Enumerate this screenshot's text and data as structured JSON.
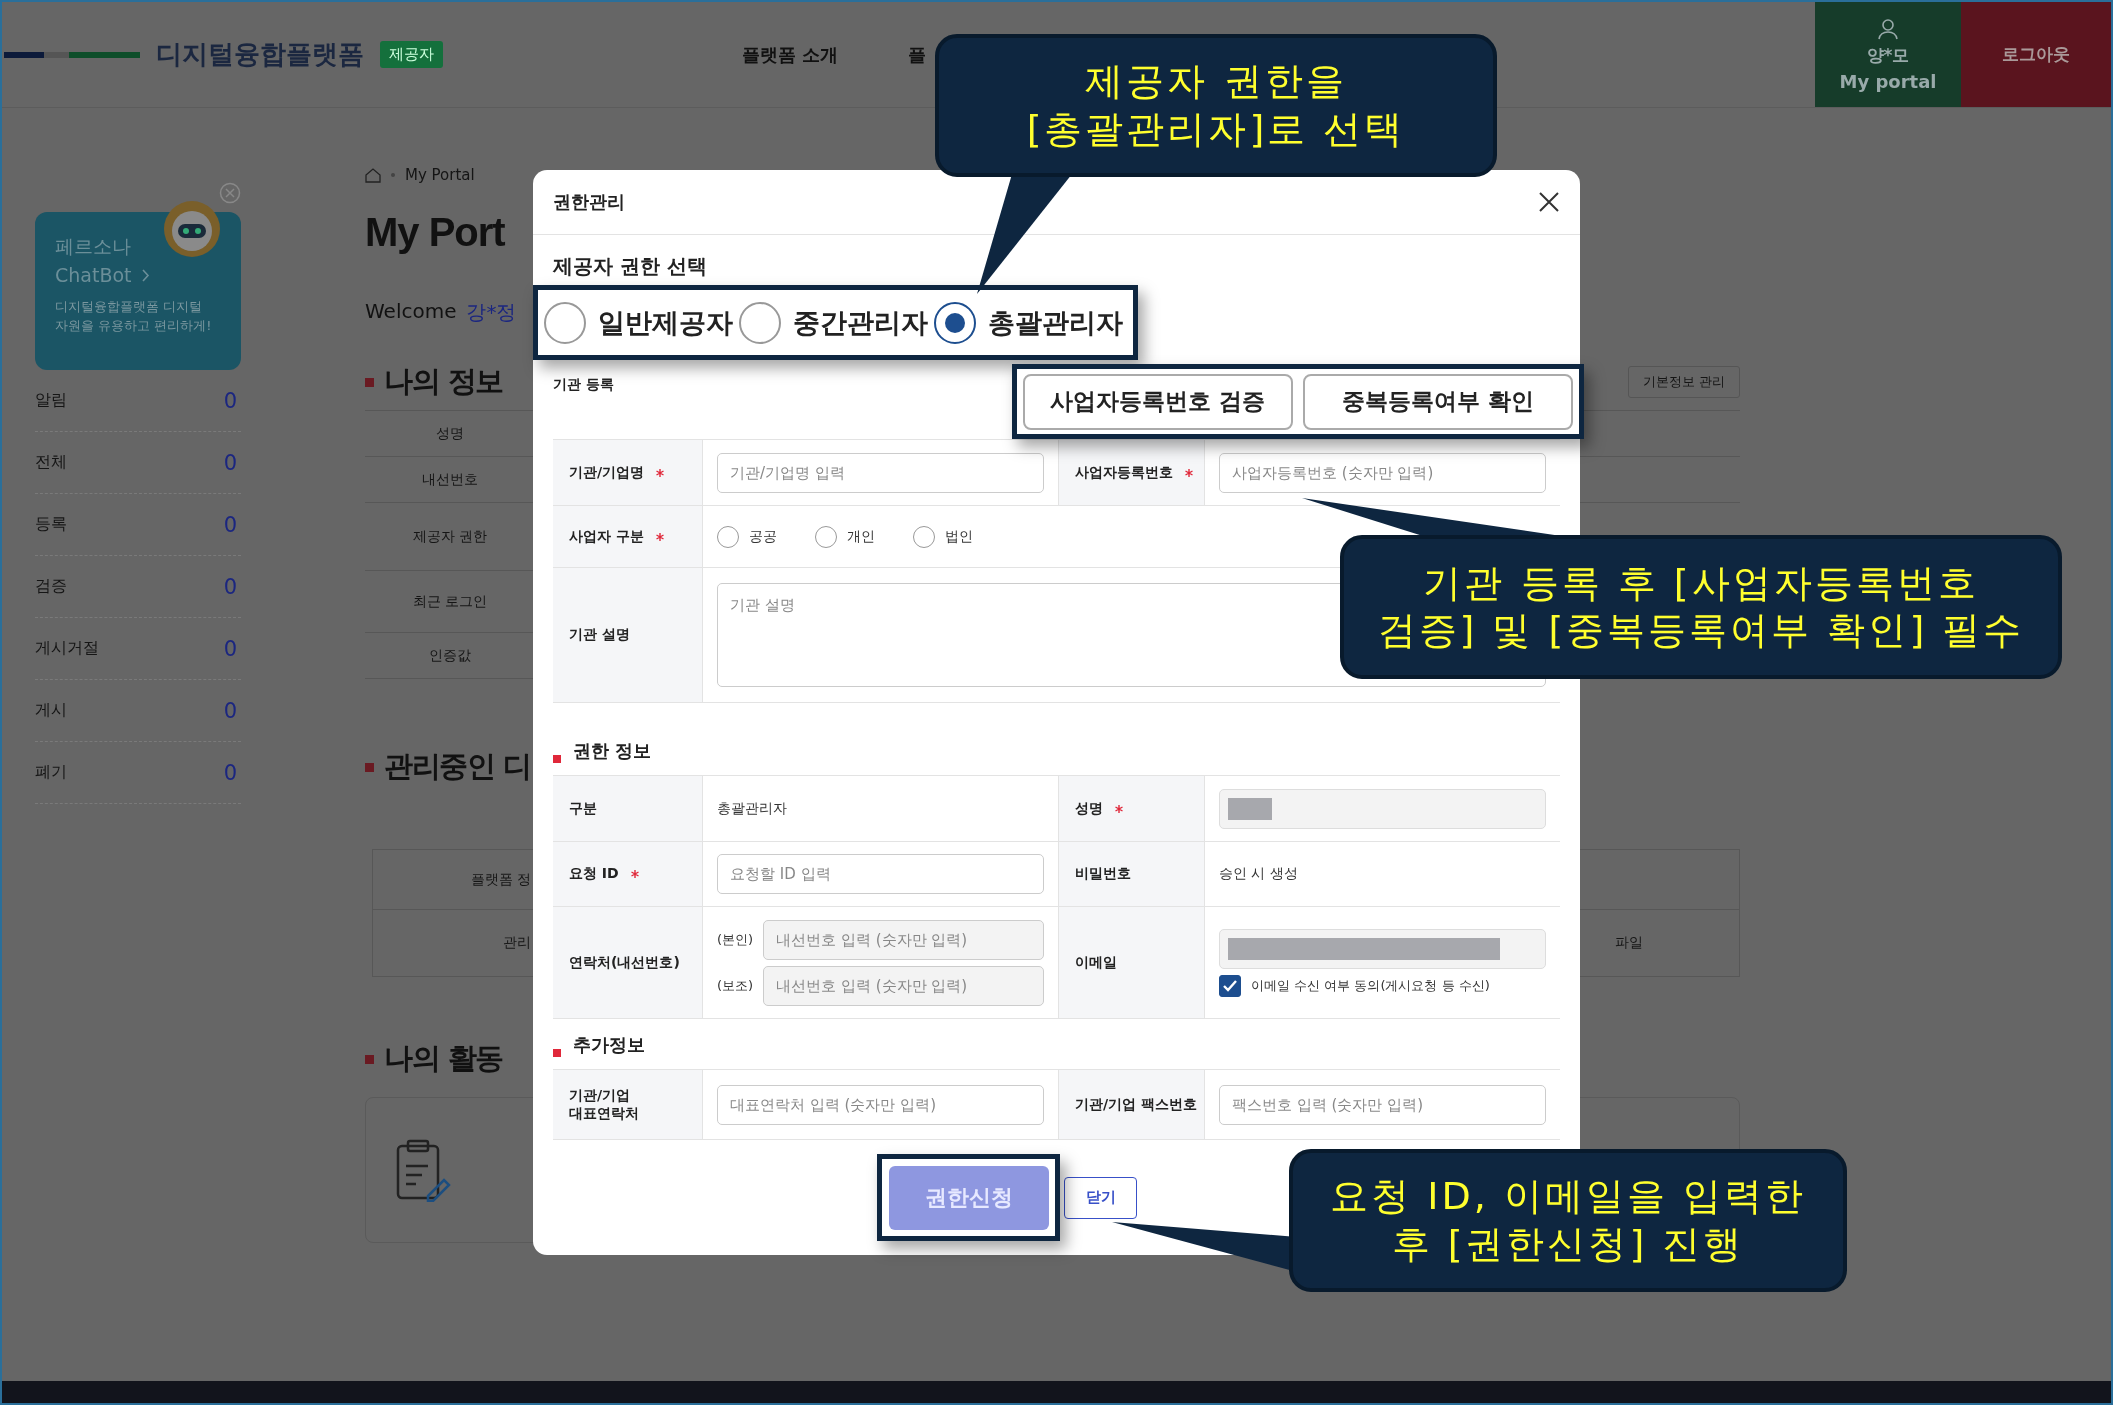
{
  "header": {
    "logo": "디지털융합플랫폼",
    "badge": "제공자",
    "nav": [
      "플랫폼 소개",
      "플"
    ],
    "user": {
      "name": "양*모",
      "link": "My portal"
    },
    "logout": "로그아웃"
  },
  "chatbot": {
    "title": "페르소나",
    "name": "ChatBot",
    "description_lines": [
      "디지털융합플랫폼 디지털",
      "자원을 유용하고 편리하게!"
    ]
  },
  "stats": [
    {
      "label": "알림",
      "count": "0"
    },
    {
      "label": "전체",
      "count": "0"
    },
    {
      "label": "등록",
      "count": "0"
    },
    {
      "label": "검증",
      "count": "0"
    },
    {
      "label": "게시거절",
      "count": "0"
    },
    {
      "label": "게시",
      "count": "0"
    },
    {
      "label": "폐기",
      "count": "0"
    }
  ],
  "breadcrumb": [
    "My Portal"
  ],
  "page_title": "My Port",
  "welcome": {
    "label": "Welcome",
    "user": "강*정"
  },
  "my_info": {
    "title": "나의 정보",
    "button": "기본정보 관리",
    "rows": [
      "성명",
      "내선번호",
      "제공자 권한",
      "최근 로그인",
      "인증값"
    ]
  },
  "managed": {
    "title": "관리중인 디",
    "columns": [
      "플랫폼 정"
    ],
    "row": [
      "관리",
      "파일"
    ]
  },
  "activity": {
    "title": "나의 활동"
  },
  "modal": {
    "title": "권한관리",
    "role_heading": "제공자 권한 선택",
    "role_options": [
      {
        "label": "일반제공자",
        "selected": false
      },
      {
        "label": "중간관리자",
        "selected": false
      },
      {
        "label": "총괄관리자",
        "selected": true
      }
    ],
    "registration": {
      "title": "기관 등록",
      "buttons": [
        "사업자등록번호 검증",
        "중복등록여부 확인"
      ],
      "rows": [
        [
          {
            "label": "기관/기업명",
            "required": true,
            "kind": "input",
            "placeholder": "기관/기업명 입력"
          },
          {
            "label": "사업자등록번호",
            "required": true,
            "kind": "input",
            "placeholder": "사업자등록번호 (숫자만 입력)"
          }
        ],
        [
          {
            "label": "사업자 구분",
            "required": true,
            "kind": "radios",
            "options": [
              {
                "label": "공공",
                "selected": false
              },
              {
                "label": "개인",
                "selected": false
              },
              {
                "label": "법인",
                "selected": false
              }
            ]
          }
        ],
        [
          {
            "label": "기관 설명",
            "required": false,
            "kind": "textarea",
            "placeholder": "기관 설명"
          }
        ]
      ]
    },
    "permission": {
      "title": "권한 정보",
      "rows": [
        [
          {
            "label": "구분",
            "required": false,
            "kind": "text",
            "value": "총괄관리자"
          },
          {
            "label": "성명",
            "required": true,
            "kind": "masked"
          }
        ],
        [
          {
            "label": "요청 ID",
            "required": true,
            "kind": "input",
            "placeholder": "요청할 ID 입력"
          },
          {
            "label": "비밀번호",
            "required": false,
            "kind": "text",
            "value": "승인 시 생성"
          }
        ],
        [
          {
            "label": "연락처(내선번호)",
            "required": false,
            "kind": "contacts",
            "fields": [
              {
                "prefix": "(본인)",
                "placeholder": "내선번호 입력 (숫자만 입력)"
              },
              {
                "prefix": "(보조)",
                "placeholder": "내선번호 입력 (숫자만 입력)"
              }
            ]
          },
          {
            "label": "이메일",
            "required": false,
            "kind": "email",
            "consent": {
              "label": "이메일 수신 여부 동의(게시요청 등 수신)",
              "checked": true
            }
          }
        ]
      ]
    },
    "extra": {
      "title": "추가정보",
      "rows": [
        [
          {
            "label": "기관/기업\n대표연락처",
            "required": false,
            "kind": "input",
            "placeholder": "대표연락처 입력 (숫자만 입력)"
          },
          {
            "label": "기관/기업 팩스번호",
            "required": false,
            "kind": "input",
            "placeholder": "팩스번호 입력 (숫자만 입력)"
          }
        ]
      ]
    },
    "submit": "권한신청",
    "close": "닫기"
  },
  "callouts": [
    {
      "lines": [
        "제공자 권한을",
        "[총괄관리자]로 선택"
      ]
    },
    {
      "lines": [
        "기관 등록 후 [사업자등록번호",
        "검증] 및 [중복등록여부 확인] 필수"
      ]
    },
    {
      "lines": [
        "요청 ID, 이메일을 입력한",
        "후 [권한신청] 진행"
      ]
    }
  ]
}
